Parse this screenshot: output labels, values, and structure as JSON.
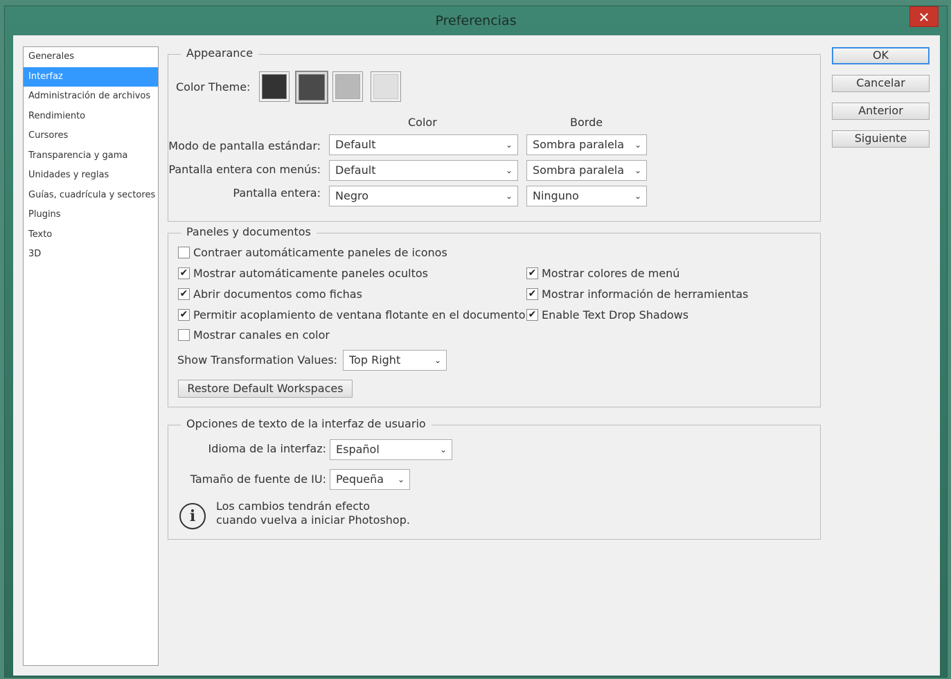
{
  "window": {
    "title": "Preferencias",
    "close_glyph": "✕"
  },
  "nav": {
    "items": [
      {
        "label": "Generales",
        "selected": false
      },
      {
        "label": "Interfaz",
        "selected": true
      },
      {
        "label": "Administración de archivos",
        "selected": false
      },
      {
        "label": "Rendimiento",
        "selected": false
      },
      {
        "label": "Cursores",
        "selected": false
      },
      {
        "label": "Transparencia y gama",
        "selected": false
      },
      {
        "label": "Unidades y reglas",
        "selected": false
      },
      {
        "label": "Guías, cuadrícula y sectores",
        "selected": false
      },
      {
        "label": "Plugins",
        "selected": false
      },
      {
        "label": "Texto",
        "selected": false
      },
      {
        "label": "3D",
        "selected": false
      }
    ]
  },
  "buttons": {
    "ok": "OK",
    "cancel": "Cancelar",
    "prev": "Anterior",
    "next": "Siguiente"
  },
  "appearance": {
    "title": "Appearance",
    "color_theme_label": "Color Theme:",
    "themes": [
      {
        "name": "darkest",
        "color": "#333333",
        "selected": false
      },
      {
        "name": "dark",
        "color": "#4a4a4a",
        "selected": true
      },
      {
        "name": "medium",
        "color": "#b8b8b8",
        "selected": false
      },
      {
        "name": "light",
        "color": "#e0e0e0",
        "selected": false
      }
    ],
    "col_color": "Color",
    "col_border": "Borde",
    "rows": [
      {
        "label": "Modo de pantalla estándar:",
        "color": "Default",
        "border": "Sombra paralela"
      },
      {
        "label": "Pantalla entera con menús:",
        "color": "Default",
        "border": "Sombra paralela"
      },
      {
        "label": "Pantalla entera:",
        "color": "Negro",
        "border": "Ninguno"
      }
    ]
  },
  "panels": {
    "title": "Paneles y documentos",
    "checkboxes_left": [
      {
        "label": "Contraer automáticamente paneles de iconos",
        "checked": false
      },
      {
        "label": "Mostrar automáticamente paneles ocultos",
        "checked": true
      },
      {
        "label": "Abrir documentos como fichas",
        "checked": true
      },
      {
        "label": "Permitir acoplamiento de ventana flotante en el documento",
        "checked": true
      },
      {
        "label": "Mostrar canales en color",
        "checked": false
      }
    ],
    "checkboxes_right": [
      {
        "label": "Mostrar colores de menú",
        "checked": true
      },
      {
        "label": "Mostrar información de herramientas",
        "checked": true
      },
      {
        "label": "Enable Text Drop Shadows",
        "checked": true
      }
    ],
    "transform_label": "Show Transformation Values:",
    "transform_value": "Top Right",
    "restore_button": "Restore Default Workspaces"
  },
  "text_options": {
    "title": "Opciones de texto de la interfaz de usuario",
    "language_label": "Idioma de la interfaz:",
    "language_value": "Español",
    "font_size_label": "Tamaño de fuente de IU:",
    "font_size_value": "Pequeña",
    "info_glyph": "i",
    "info_line1": "Los cambios tendrán efecto",
    "info_line2": "cuando vuelva a iniciar Photoshop.",
    "checkmark": "✔",
    "chevron": "⌄"
  }
}
